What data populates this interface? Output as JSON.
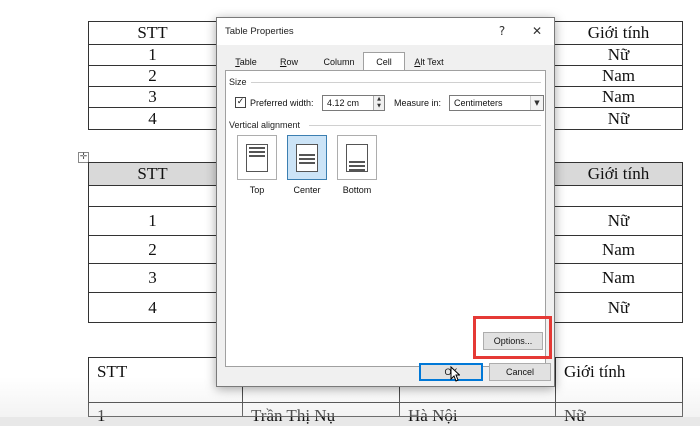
{
  "document": {
    "table1": {
      "header": [
        "STT",
        "Giới tính"
      ],
      "rows": [
        {
          "stt": "1",
          "gender": "Nữ"
        },
        {
          "stt": "2",
          "gender": "Nam"
        },
        {
          "stt": "3",
          "gender": "Nam"
        },
        {
          "stt": "4",
          "gender": "Nữ"
        }
      ]
    },
    "table2": {
      "header": [
        "STT",
        "Giới tính"
      ],
      "rows": [
        {
          "stt": "1",
          "gender": "Nữ"
        },
        {
          "stt": "2",
          "gender": "Nam"
        },
        {
          "stt": "3",
          "gender": "Nam"
        },
        {
          "stt": "4",
          "gender": "Nữ"
        }
      ]
    },
    "table3": {
      "header": [
        "STT",
        "Giới tính"
      ],
      "partial_row": [
        "1",
        "Trần Thị Nụ",
        "Hà Nội",
        "Nữ"
      ]
    },
    "move_handle_glyph": "✛"
  },
  "dialog": {
    "title": "Table Properties",
    "help_glyph": "?",
    "close_glyph": "✕",
    "tabs": [
      {
        "label": "Table",
        "key": "T",
        "rest": "able",
        "active": false
      },
      {
        "label": "Row",
        "key": "R",
        "rest": "ow",
        "active": false
      },
      {
        "label": "Column",
        "key": "",
        "rest": "Column",
        "active": false
      },
      {
        "label": "Cell",
        "key": "",
        "rest": "Cell",
        "active": true
      },
      {
        "label": "Alt Text",
        "key": "A",
        "rest": "lt Text",
        "active": false
      }
    ],
    "size": {
      "group_label": "Size",
      "checkbox_checked": true,
      "check_glyph": "✓",
      "preferred_width_label": "Preferred width:",
      "preferred_width_value": "4.12 cm",
      "measure_in_label": "Measure in:",
      "measure_in_value": "Centimeters"
    },
    "vertical_alignment": {
      "group_label": "Vertical alignment",
      "options": [
        {
          "label": "Top",
          "selected": false
        },
        {
          "label": "Center",
          "selected": true
        },
        {
          "label": "Bottom",
          "selected": false
        }
      ]
    },
    "buttons": {
      "options": "Options...",
      "ok": "OK",
      "cancel": "Cancel"
    }
  },
  "colors": {
    "highlight": "#e53935",
    "selected_alignment": "#cce4f7",
    "header_shade": "#d9d9d9"
  }
}
